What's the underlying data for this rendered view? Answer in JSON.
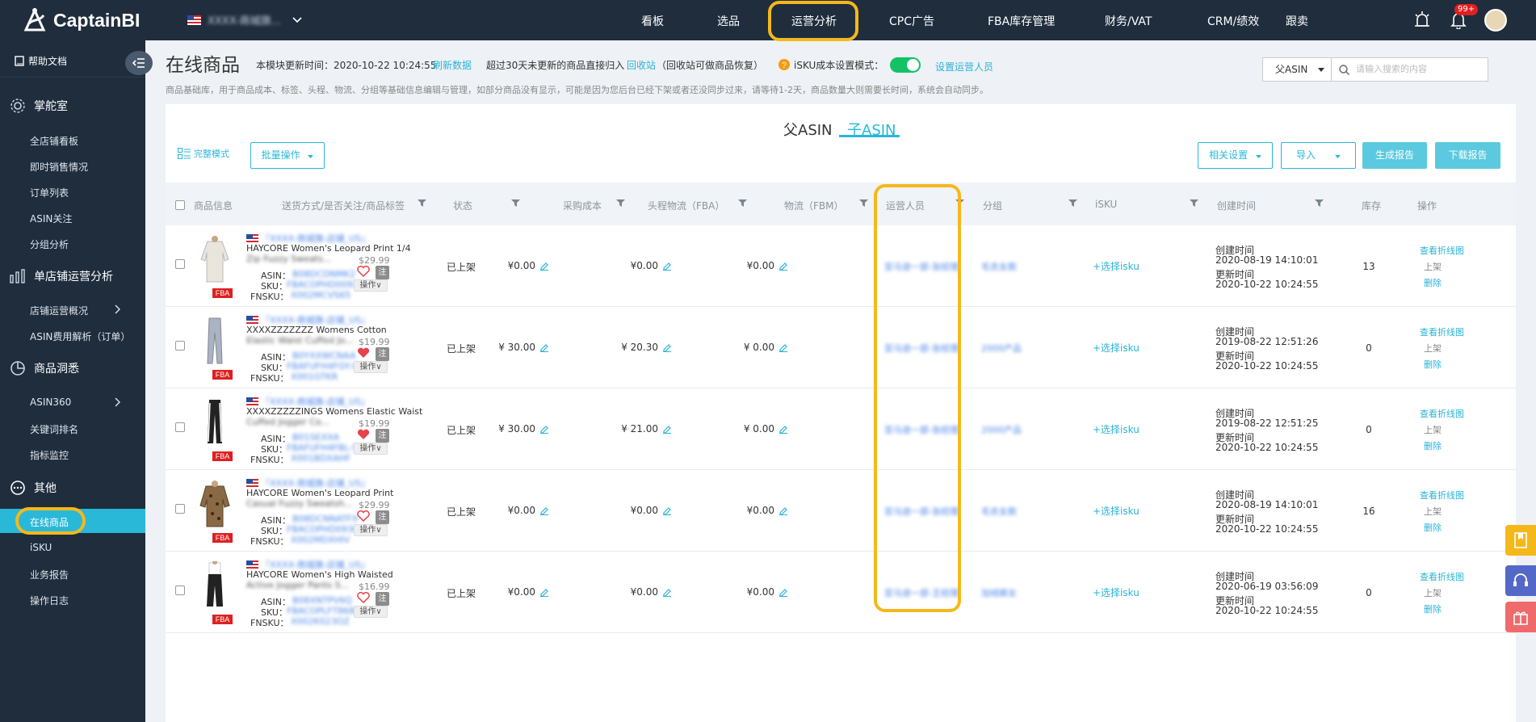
{
  "app": {
    "logo_text": "CaptainBI",
    "store_name": "XXXX-商城旗...",
    "notification_count": "99+"
  },
  "nav": {
    "items": [
      "看板",
      "选品",
      "运营分析",
      "CPC广告",
      "FBA库存管理",
      "财务/VAT",
      "CRM/绩效",
      "跟卖"
    ],
    "active": "运营分析"
  },
  "sidebar": {
    "help": "帮助文档",
    "sections": [
      {
        "title": "掌舵室",
        "items": [
          "全店铺看板",
          "即时销售情况",
          "订单列表",
          "ASIN关注",
          "分组分析"
        ]
      },
      {
        "title": "单店铺运营分析",
        "items": [
          "店铺运营概况",
          "ASIN费用解析（订单）"
        ]
      },
      {
        "title": "商品洞悉",
        "items": [
          "ASIN360",
          "关键词排名",
          "指标监控"
        ]
      },
      {
        "title": "其他",
        "items": [
          "在线商品",
          "iSKU",
          "业务报告",
          "操作日志"
        ]
      }
    ],
    "active_item": "在线商品"
  },
  "page": {
    "title": "在线商品",
    "update_text": "本模块更新时间：2020-10-22 10:24:55",
    "refresh_link": "刷新数据",
    "recycle_text": "超过30天未更新的商品直接归入",
    "recycle_link": "回收站",
    "recycle_note": "（回收站可做商品恢复）",
    "isku_mode_label": "iSKU成本设置模式：",
    "isku_mode_on": true,
    "set_operator_link": "设置运营人员",
    "description": "商品基础库，用于商品成本、标签、头程、物流、分组等基础信息编辑与管理，如部分商品没有显示，可能是因为您后台已经下架或者还没同步过来，请等待1-2天，商品数量大则需要长时间，系统会自动同步。",
    "search": {
      "select_value": "父ASIN",
      "placeholder": "请输入搜索的内容"
    }
  },
  "card": {
    "tabs": [
      "父ASIN",
      "子ASIN"
    ],
    "active_tab": "子ASIN",
    "mode_label": "完整模式",
    "batch_button": "批量操作",
    "related_settings": "相关设置",
    "import": "导入",
    "generate_report": "生成报告",
    "download_report": "下载报告"
  },
  "table": {
    "columns": [
      "商品信息",
      "送货方式/是否关注/商品标签",
      "状态",
      "采购成本",
      "头程物流（FBA）",
      "物流（FBM）",
      "运营人员",
      "分组",
      "iSKU",
      "创建时间",
      "库存",
      "操作"
    ],
    "label_asin": "ASIN：",
    "label_sku": "SKU：",
    "label_fnsku": "FNSKU：",
    "label_created": "创建时间",
    "label_updated": "更新时间",
    "label_fba": "FBA",
    "label_note": "注",
    "label_ops": "操作∨",
    "rows": [
      {
        "store": "『XXXX-商城旗-店铺_US』",
        "title1": "HAYCORE Women's Leopard Print 1/4",
        "title2": "Zip Fuzzy Sweats...",
        "price": "$29.99",
        "liked": false,
        "asin": "B08DCDNMK2",
        "sku": "FBACOPHD0093...",
        "fnsku": "X002MCVS65",
        "status": "已上架",
        "cost": "¥0.00",
        "fba": "¥0.00",
        "fbm": "¥0.00",
        "operator": "亚马逊一部-张经理",
        "group": "毛衣女款",
        "isku": "+选择isku",
        "created": "2020-08-19 14:10:01",
        "updated": "2020-10-22 10:24:55",
        "stock": "13",
        "act_chart": "查看折线图",
        "act_status": "上架",
        "act_delete": "删除",
        "img": "sweater"
      },
      {
        "store": "『XXXX-商城旗-店铺_US』",
        "title1": "XXXXZZZZZZZ Womens Cotton",
        "title2": "Elastic Waist Cuffed Jo...",
        "price": "$19.99",
        "liked": true,
        "asin": "B0YXXWCNAA",
        "sku": "FBAFUFH4FGY-XL",
        "fnsku": "X001GTKR",
        "status": "已上架",
        "cost": "¥ 30.00",
        "fba": "¥ 20.30",
        "fbm": "¥ 0.00",
        "operator": "亚马逊一部-张经理",
        "group": "2000产品",
        "isku": "+选择isku",
        "created": "2019-08-22 12:51:26",
        "updated": "2020-10-22 10:24:55",
        "stock": "0",
        "act_chart": "查看折线图",
        "act_status": "上架",
        "act_delete": "删除",
        "img": "legging"
      },
      {
        "store": "『XXXX-商城旗-店铺_US』",
        "title1": "XXXXZZZZZINGS Womens Elastic Waist",
        "title2": "Cuffed Jogger Co...",
        "price": "$19.99",
        "liked": true,
        "asin": "B01SEXXA",
        "sku": "FBAFUFH4FBL-S",
        "fnsku": "X001BDXAHF",
        "status": "已上架",
        "cost": "¥ 30.00",
        "fba": "¥ 21.00",
        "fbm": "¥ 0.00",
        "operator": "亚马逊一部-张经理",
        "group": "2000产品",
        "isku": "+选择isku",
        "created": "2019-08-22 12:51:25",
        "updated": "2020-10-22 10:24:55",
        "stock": "0",
        "act_chart": "查看折线图",
        "act_status": "上架",
        "act_delete": "删除",
        "img": "jogger"
      },
      {
        "store": "『XXXX-商城旗-店铺_US』",
        "title1": "HAYCORE Women's Leopard Print",
        "title2": "Casual Fuzzy Sweatsh...",
        "price": "$29.99",
        "liked": false,
        "asin": "B08DCNNATFX",
        "sku": "FBACOPHD093K...",
        "fnsku": "X002MDXHIV",
        "status": "已上架",
        "cost": "¥0.00",
        "fba": "¥0.00",
        "fbm": "¥0.00",
        "operator": "亚马逊一部-张经理",
        "group": "毛衣女款",
        "isku": "+选择isku",
        "created": "2020-08-19 14:10:01",
        "updated": "2020-10-22 10:24:55",
        "stock": "16",
        "act_chart": "查看折线图",
        "act_status": "上架",
        "act_delete": "删除",
        "img": "leopard"
      },
      {
        "store": "『XXXX-商城旗-店铺_US』",
        "title1": "HAYCORE Women's High Waisted",
        "title2": "Active Jogger Pants S...",
        "price": "$16.99",
        "liked": false,
        "asin": "B08XNTPV6Q",
        "sku": "FBACOPLFT868L-L",
        "fnsku": "X002K023OZ",
        "status": "已上架",
        "cost": "¥0.00",
        "fba": "¥0.00",
        "fbm": "¥0.00",
        "operator": "亚马逊一部-王经理",
        "group": "加绒裤女",
        "isku": "+选择isku",
        "created": "2020-06-19 03:56:09",
        "updated": "2020-10-22 10:24:55",
        "stock": "0",
        "act_chart": "查看折线图",
        "act_status": "上架",
        "act_delete": "删除",
        "img": "pants"
      }
    ]
  },
  "colors": {
    "topbar": "#1f2d3d",
    "accent": "#29b8d8",
    "highlight": "#f5b81b",
    "fba_badge": "#e02020",
    "toggle_on": "#13c265"
  }
}
